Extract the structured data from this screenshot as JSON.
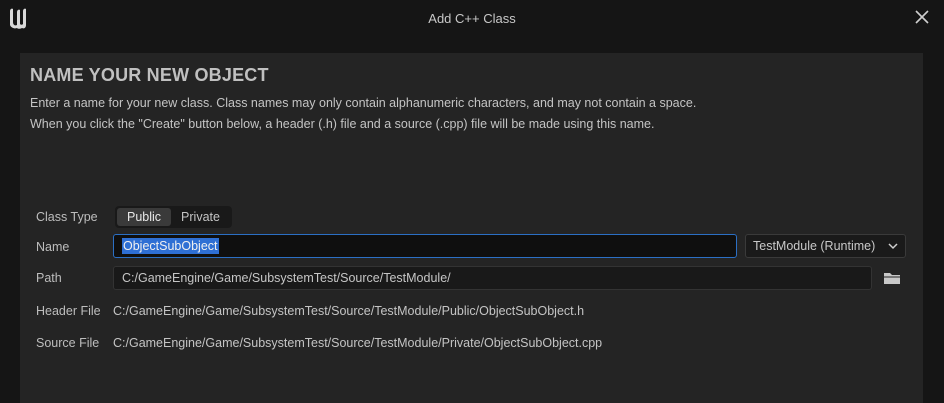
{
  "window": {
    "title": "Add C++ Class",
    "logo_icon": "unreal-logo-icon",
    "close_icon": "close-icon"
  },
  "panel": {
    "heading": "NAME YOUR NEW OBJECT",
    "description_line1": "Enter a name for your new class. Class names may only contain alphanumeric characters, and may not contain a space.",
    "description_line2": "When you click the \"Create\" button below, a header (.h) file and a source (.cpp) file will be made using this name."
  },
  "form": {
    "class_type_label": "Class Type",
    "class_type_options": [
      "Public",
      "Private"
    ],
    "class_type_selected": "Public",
    "name_label": "Name",
    "name_value": "ObjectSubObject",
    "module_value": "TestModule (Runtime)",
    "path_label": "Path",
    "path_value": "C:/GameEngine/Game/SubsystemTest/Source/TestModule/",
    "header_label": "Header File",
    "header_value": "C:/GameEngine/Game/SubsystemTest/Source/TestModule/Public/ObjectSubObject.h",
    "source_label": "Source File",
    "source_value": "C:/GameEngine/Game/SubsystemTest/Source/TestModule/Private/ObjectSubObject.cpp"
  },
  "colors": {
    "accent": "#2e6fd4",
    "panel_bg": "#242424",
    "window_bg": "#151515"
  }
}
